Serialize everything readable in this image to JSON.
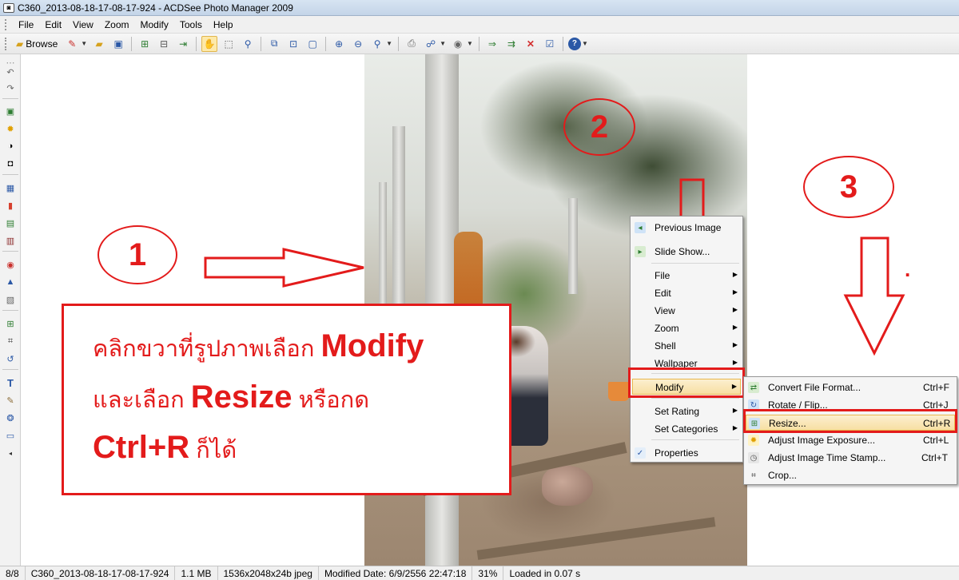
{
  "window": {
    "title": "C360_2013-08-18-17-08-17-924 - ACDSee Photo Manager 2009"
  },
  "menubar": {
    "items": [
      "File",
      "Edit",
      "View",
      "Zoom",
      "Modify",
      "Tools",
      "Help"
    ]
  },
  "toolbar": {
    "browse_label": "Browse"
  },
  "annotations": {
    "step1": "1",
    "step2": "2",
    "step3": "3",
    "dot": ".",
    "instructions": {
      "line1_text": "คลิกขวาที่รูปภาพเลือก ",
      "line1_bold": "Modify",
      "line2_text_a": "และเลือก ",
      "line2_bold": "Resize",
      "line2_text_b": " หรือกด",
      "line3_bold": "Ctrl+R",
      "line3_text": " ก็ได้"
    },
    "accent_color": "#e31b1b"
  },
  "context_menu": {
    "items": [
      {
        "label": "Previous Image",
        "icon": "previous-image-icon"
      },
      {
        "label": "Slide Show...",
        "icon": "slideshow-icon"
      },
      {
        "label": "File"
      },
      {
        "label": "Edit"
      },
      {
        "label": "View"
      },
      {
        "label": "Zoom"
      },
      {
        "label": "Shell"
      },
      {
        "label": "Wallpaper"
      },
      {
        "label": "Modify"
      },
      {
        "label": "Set Rating"
      },
      {
        "label": "Set Categories"
      },
      {
        "label": "Properties",
        "icon": "properties-icon"
      }
    ]
  },
  "modify_submenu": {
    "items": [
      {
        "label": "Convert File Format...",
        "shortcut": "Ctrl+F",
        "icon": "convert-icon"
      },
      {
        "label": "Rotate / Flip...",
        "shortcut": "Ctrl+J",
        "icon": "rotate-icon"
      },
      {
        "label": "Resize...",
        "shortcut": "Ctrl+R",
        "icon": "resize-icon"
      },
      {
        "label": "Adjust Image Exposure...",
        "shortcut": "Ctrl+L",
        "icon": "exposure-icon"
      },
      {
        "label": "Adjust Image Time Stamp...",
        "shortcut": "Ctrl+T",
        "icon": "timestamp-icon"
      },
      {
        "label": "Crop...",
        "shortcut": "",
        "icon": "crop-icon"
      }
    ]
  },
  "statusbar": {
    "index": "8/8",
    "filename": "C360_2013-08-18-17-08-17-924",
    "size": "1.1 MB",
    "dimensions": "1536x2048x24b jpeg",
    "modified": "Modified Date: 6/9/2556 22:47:18",
    "zoom": "31%",
    "loaded": "Loaded in 0.07 s"
  }
}
